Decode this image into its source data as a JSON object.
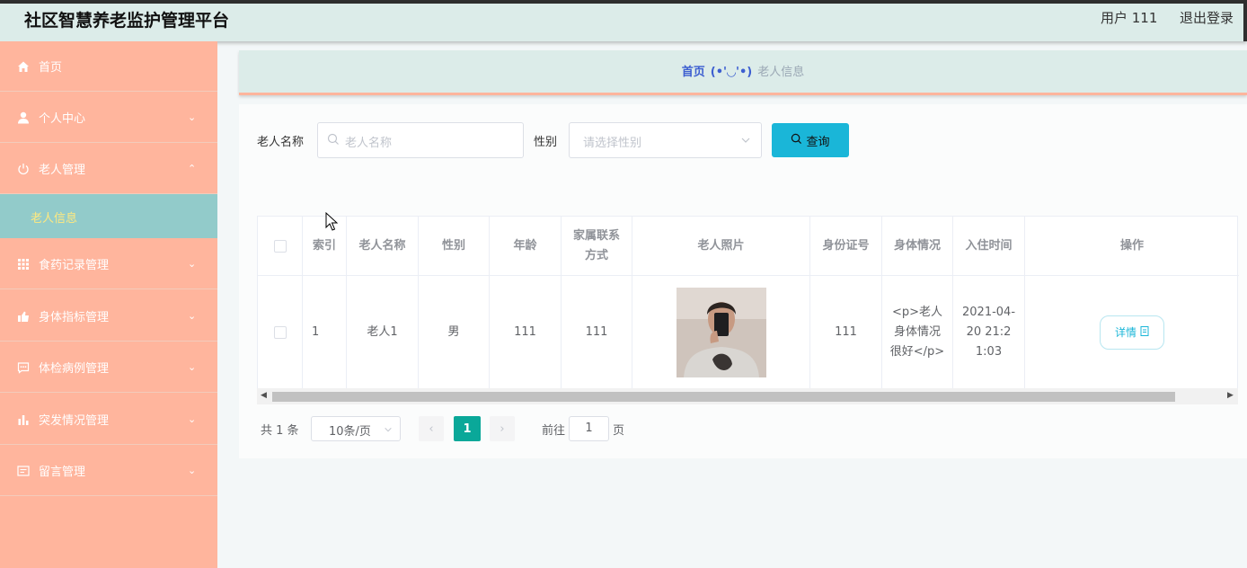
{
  "header": {
    "title": "社区智慧养老监护管理平台",
    "user": "用户 111",
    "logout": "退出登录"
  },
  "sidebar": {
    "items": [
      {
        "label": "首页",
        "icon": "home-icon"
      },
      {
        "label": "个人中心",
        "icon": "user-icon"
      },
      {
        "label": "老人管理",
        "icon": "power-icon"
      },
      {
        "label": "食药记录管理",
        "icon": "grid-icon"
      },
      {
        "label": "身体指标管理",
        "icon": "thumb-icon"
      },
      {
        "label": "体检病例管理",
        "icon": "chat-icon"
      },
      {
        "label": "突发情况管理",
        "icon": "bar-chart-icon"
      },
      {
        "label": "留言管理",
        "icon": "message-box-icon"
      }
    ],
    "active_sub": "老人信息",
    "colors": {
      "bg": "#ffb59d",
      "sub_bg": "#92cbca",
      "sub_text": "#ffe97f"
    }
  },
  "breadcrumb": {
    "home": "首页",
    "separator": "(•'◡'•)",
    "current": "老人信息"
  },
  "search": {
    "name_label": "老人名称",
    "name_placeholder": "老人名称",
    "gender_label": "性别",
    "gender_placeholder": "请选择性别",
    "query_button": "查询"
  },
  "table": {
    "columns": [
      "索引",
      "老人名称",
      "性别",
      "年龄",
      "家属联系方式",
      "老人照片",
      "身份证号",
      "身体情况",
      "入住时间",
      "操作"
    ],
    "rows": [
      {
        "index": "1",
        "name": "老人1",
        "gender": "男",
        "age": "111",
        "contact": "111",
        "photo": "person-photo",
        "id_card": "111",
        "health": "<p>老人身体情况很好</p>",
        "checkin": "2021-04-20 21:21:03",
        "action": "详情"
      }
    ]
  },
  "pagination": {
    "total": "共 1 条",
    "page_size": "10条/页",
    "current": "1",
    "goto_label": "前往",
    "goto_value": "1",
    "page_suffix": "页"
  }
}
